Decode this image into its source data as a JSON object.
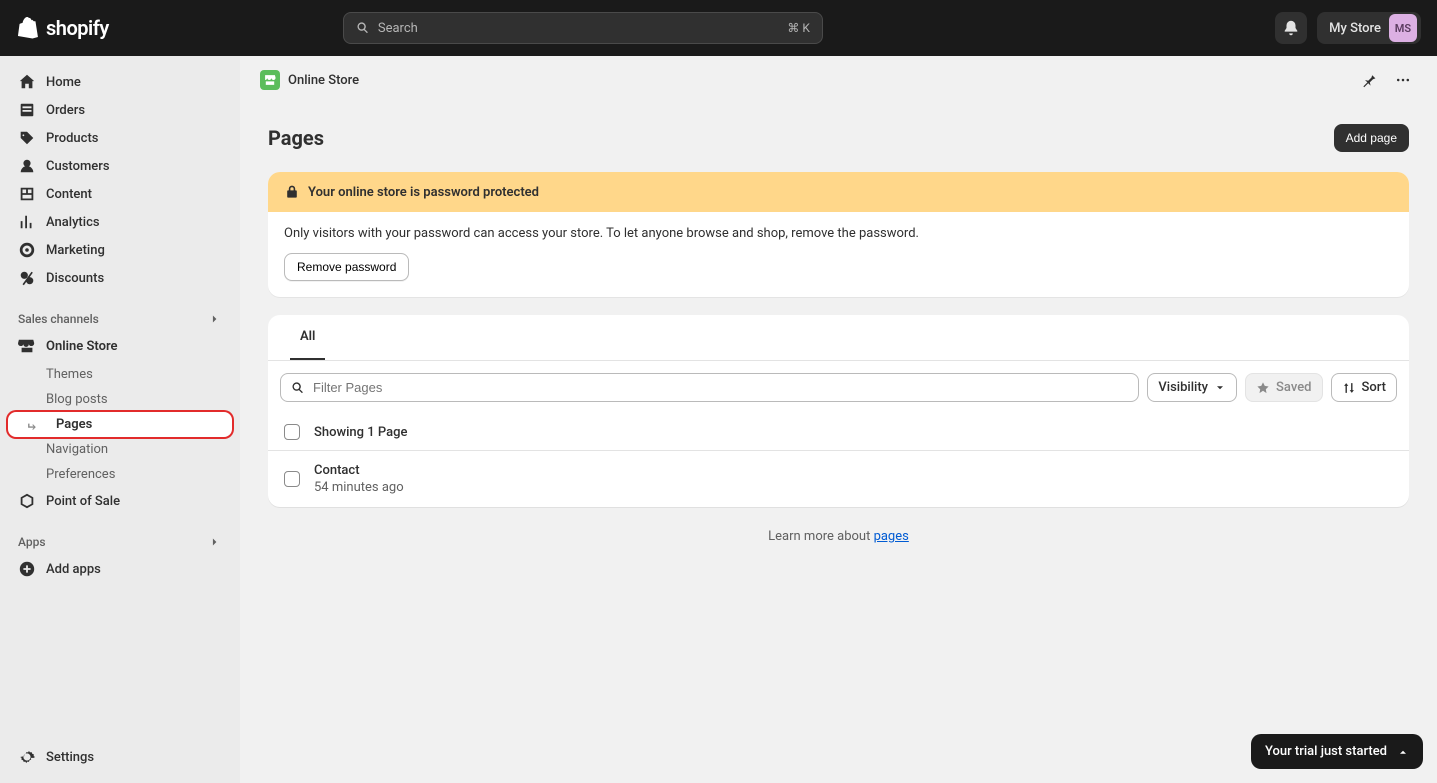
{
  "header": {
    "brand": "shopify",
    "search_placeholder": "Search",
    "search_kbd": "⌘ K",
    "store_name": "My Store",
    "avatar_initials": "MS"
  },
  "sidebar": {
    "primary": [
      {
        "label": "Home",
        "icon": "home"
      },
      {
        "label": "Orders",
        "icon": "orders"
      },
      {
        "label": "Products",
        "icon": "products"
      },
      {
        "label": "Customers",
        "icon": "customers"
      },
      {
        "label": "Content",
        "icon": "content"
      },
      {
        "label": "Analytics",
        "icon": "analytics"
      },
      {
        "label": "Marketing",
        "icon": "marketing"
      },
      {
        "label": "Discounts",
        "icon": "discounts"
      }
    ],
    "sales_channels_label": "Sales channels",
    "online_store_label": "Online Store",
    "online_store_sub": [
      {
        "label": "Themes"
      },
      {
        "label": "Blog posts"
      },
      {
        "label": "Pages",
        "active": true
      },
      {
        "label": "Navigation"
      },
      {
        "label": "Preferences"
      }
    ],
    "pos_label": "Point of Sale",
    "apps_label": "Apps",
    "add_apps_label": "Add apps",
    "settings_label": "Settings"
  },
  "breadcrumb": {
    "label": "Online Store"
  },
  "page": {
    "title": "Pages",
    "add_button": "Add page"
  },
  "banner": {
    "title": "Your online store is password protected",
    "body": "Only visitors with your password can access your store. To let anyone browse and shop, remove the password.",
    "action": "Remove password"
  },
  "tabs": {
    "all": "All"
  },
  "filter": {
    "placeholder": "Filter Pages",
    "visibility": "Visibility",
    "saved": "Saved",
    "sort": "Sort"
  },
  "list": {
    "count_label": "Showing 1 Page",
    "rows": [
      {
        "title": "Contact",
        "subtitle": "54 minutes ago"
      }
    ]
  },
  "footer": {
    "learn_prefix": "Learn more about ",
    "learn_link": "pages"
  },
  "trial": {
    "text": "Your trial just started"
  }
}
